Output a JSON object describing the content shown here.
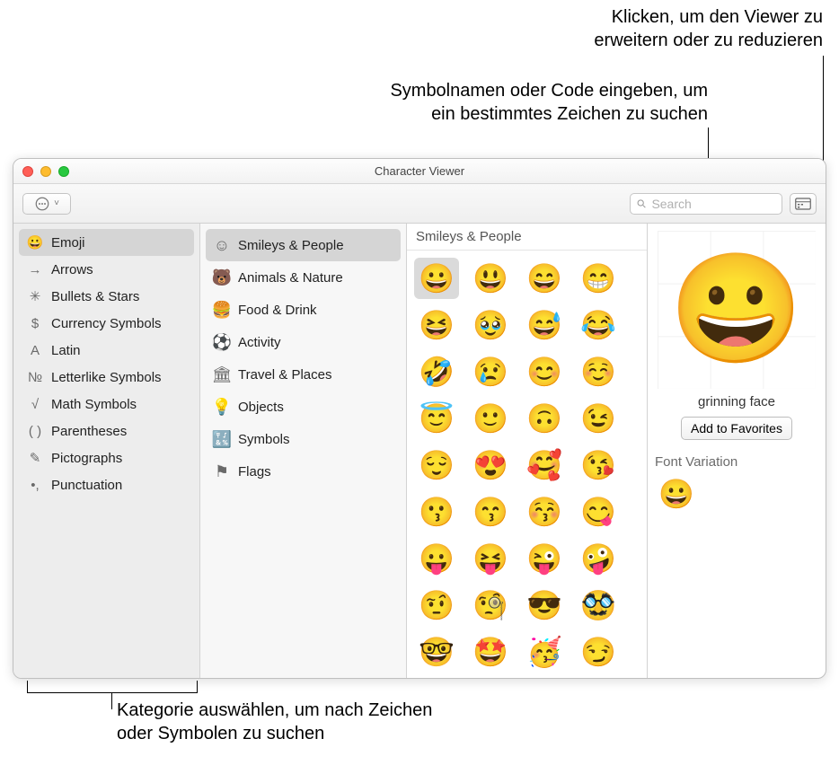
{
  "callouts": {
    "expand": {
      "line1": "Klicken, um den Viewer zu",
      "line2": "erweitern oder zu reduzieren"
    },
    "search": {
      "line1": "Symbolnamen oder Code eingeben, um",
      "line2": "ein bestimmtes Zeichen zu suchen"
    },
    "category": {
      "line1": "Kategorie auswählen, um nach Zeichen",
      "line2": "oder Symbolen zu suchen"
    }
  },
  "window": {
    "title": "Character Viewer",
    "search_placeholder": "Search"
  },
  "sidebar1": [
    {
      "icon": "😀",
      "label": "Emoji",
      "selected": true
    },
    {
      "icon": "→",
      "label": "Arrows"
    },
    {
      "icon": "✳",
      "label": "Bullets & Stars"
    },
    {
      "icon": "$",
      "label": "Currency Symbols"
    },
    {
      "icon": "A",
      "label": "Latin"
    },
    {
      "icon": "№",
      "label": "Letterlike Symbols"
    },
    {
      "icon": "√",
      "label": "Math Symbols"
    },
    {
      "icon": "( )",
      "label": "Parentheses"
    },
    {
      "icon": "✎",
      "label": "Pictographs"
    },
    {
      "icon": "•,",
      "label": "Punctuation"
    }
  ],
  "sidebar2": [
    {
      "icon": "☺",
      "label": "Smileys & People",
      "selected": true
    },
    {
      "icon": "🐻",
      "label": "Animals & Nature"
    },
    {
      "icon": "🍔",
      "label": "Food & Drink"
    },
    {
      "icon": "⚽",
      "label": "Activity"
    },
    {
      "icon": "🏛",
      "label": "Travel & Places"
    },
    {
      "icon": "💡",
      "label": "Objects"
    },
    {
      "icon": "🔣",
      "label": "Symbols"
    },
    {
      "icon": "⚑",
      "label": "Flags"
    }
  ],
  "grid": {
    "header": "Smileys & People",
    "cells": [
      "😀",
      "😃",
      "😄",
      "😁",
      "😆",
      "🥹",
      "😅",
      "😂",
      "🤣",
      "😢",
      "😊",
      "☺️",
      "😇",
      "🙂",
      "🙃",
      "😉",
      "😌",
      "😍",
      "🥰",
      "😘",
      "😗",
      "😙",
      "😚",
      "😋",
      "😛",
      "😝",
      "😜",
      "🤪",
      "🤨",
      "🧐",
      "😎",
      "🥸",
      "🤓",
      "🤩",
      "🥳",
      "😏"
    ],
    "selected_index": 0
  },
  "preview": {
    "emoji": "😀",
    "name": "grinning face",
    "favorites_button": "Add to Favorites",
    "font_variation_label": "Font Variation",
    "font_variation_cells": [
      "😀"
    ]
  }
}
